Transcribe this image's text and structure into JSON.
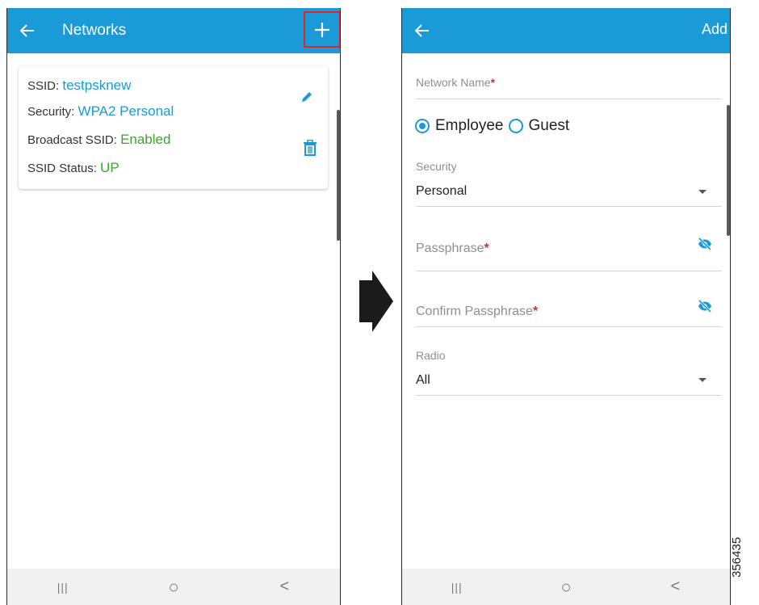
{
  "colors": {
    "brand": "#1a9ad6",
    "ok": "#3aa62a",
    "required": "#d32f2f",
    "highlight": "#e0262b"
  },
  "left_screen": {
    "title": "Networks",
    "icons": {
      "back": "arrow-left-icon",
      "add": "plus-icon",
      "edit": "pencil-icon",
      "delete": "trash-icon"
    },
    "network_card": {
      "ssid_label": "SSID: ",
      "ssid_value": "testpsknew",
      "security_label": "Security: ",
      "security_value": "WPA2 Personal",
      "broadcast_label": "Broadcast SSID: ",
      "broadcast_value": "Enabled",
      "status_label": "SSID Status: ",
      "status_value": "UP"
    }
  },
  "right_screen": {
    "action_label": "Add",
    "network_name": {
      "label": "Network Name",
      "required_mark": "*"
    },
    "network_type": {
      "options": [
        "Employee",
        "Guest"
      ],
      "selected": "Employee"
    },
    "security": {
      "label": "Security",
      "value": "Personal"
    },
    "passphrase": {
      "placeholder": "Passphrase",
      "required_mark": "*"
    },
    "confirm_passphrase": {
      "placeholder": "Confirm Passphrase",
      "required_mark": "*"
    },
    "radio": {
      "label": "Radio",
      "value": "All"
    }
  },
  "system_nav": {
    "recents": "|||",
    "home": "○",
    "back": "<"
  },
  "figure_id": "356435"
}
